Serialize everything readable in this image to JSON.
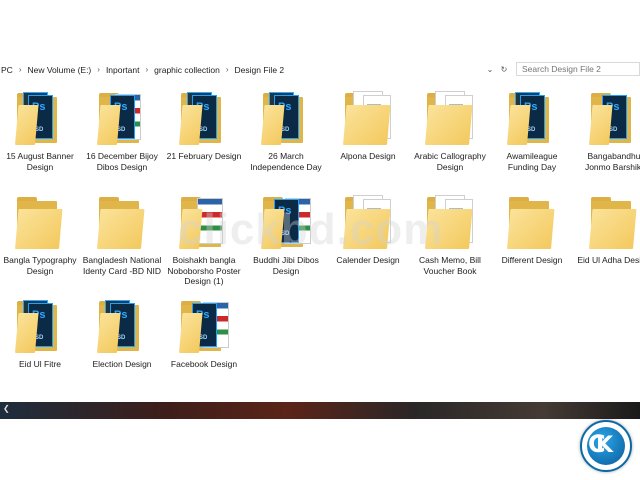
{
  "address_bar": {
    "crumbs": [
      "PC",
      "New Volume (E:)",
      "Inportant",
      "graphic collection",
      "Design File 2"
    ],
    "chevron": "›",
    "dropdown_glyph": "⌄",
    "refresh_glyph": "↻"
  },
  "search": {
    "placeholder": "Search Design File 2"
  },
  "items": [
    {
      "label": "15 August Banner Design",
      "icon": "psd"
    },
    {
      "label": "16 December Bijoy Dibos Design",
      "icon": "mixed"
    },
    {
      "label": "21 February Design",
      "icon": "psd"
    },
    {
      "label": "26 March Independence Day",
      "icon": "psd"
    },
    {
      "label": "Alpona Design",
      "icon": "doc"
    },
    {
      "label": "Arabic Callography Design",
      "icon": "doc"
    },
    {
      "label": "Awamileague Funding Day",
      "icon": "psd"
    },
    {
      "label": "Bangabandhu Jonmo Barshiki",
      "icon": "psd-single"
    },
    {
      "label": "Bangla Typography Design",
      "icon": "empty"
    },
    {
      "label": "Bangladesh National Identy Card -BD NID",
      "icon": "empty"
    },
    {
      "label": "Boishakh bangla Noboborsho Poster Design (1)",
      "icon": "image"
    },
    {
      "label": "Buddhi Jibi Dibos Design",
      "icon": "psd-image"
    },
    {
      "label": "Calender Design",
      "icon": "doc"
    },
    {
      "label": "Cash Memo, Bill Voucher Book",
      "icon": "doc"
    },
    {
      "label": "Different Design",
      "icon": "empty"
    },
    {
      "label": "Eid Ul Adha Design",
      "icon": "empty"
    },
    {
      "label": "Eid Ul Fitre",
      "icon": "psd"
    },
    {
      "label": "Election Design",
      "icon": "psd"
    },
    {
      "label": "Facebook Design",
      "icon": "psd-image"
    }
  ],
  "psd_text": {
    "ps": "Ps",
    "sub": "PSD"
  },
  "watermark": "clickbd.com",
  "bottom": {
    "arrow": "❮"
  },
  "logo": {
    "text_c": "C",
    "text_k": "K"
  },
  "colors": {
    "folder": "#f3c95e",
    "ps_blue": "#31a8ff",
    "ps_dark": "#0b2a45",
    "accent": "#0b6aa6"
  }
}
